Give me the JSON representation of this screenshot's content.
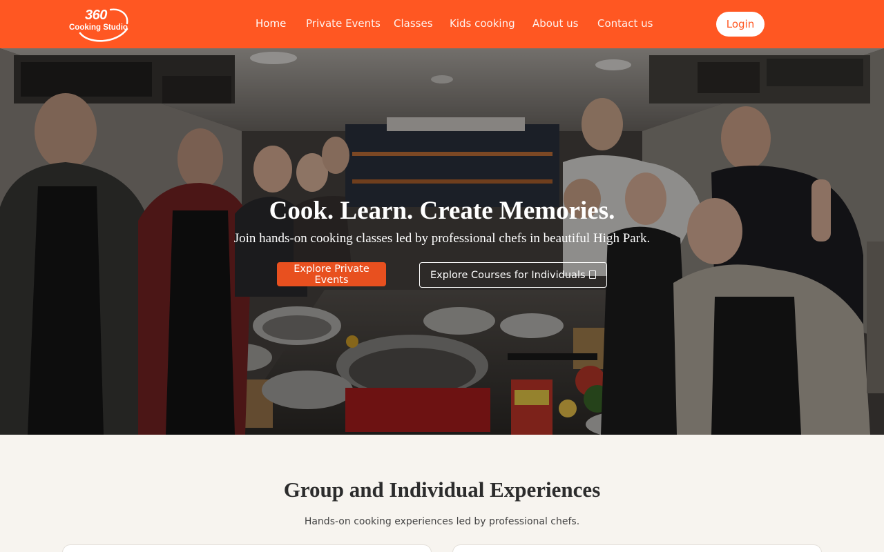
{
  "brand": {
    "logo_number": "360",
    "logo_text": "Cooking Studio"
  },
  "nav": {
    "items": [
      {
        "label": "Home"
      },
      {
        "label": "Private Events"
      },
      {
        "label": "Classes"
      },
      {
        "label": "Kids cooking"
      },
      {
        "label": "About us"
      },
      {
        "label": "Contact us"
      }
    ],
    "active": "Home",
    "login_label": "Login"
  },
  "hero": {
    "title": "Cook. Learn. Create Memories.",
    "subtitle": "Join hands-on cooking classes led by professional chefs in beautiful High Park.",
    "primary_button": "Explore Private Events",
    "secondary_button": "Explore Courses for Individuals",
    "secondary_button_icon": "external-link-icon"
  },
  "section": {
    "title": "Group and Individual Experiences",
    "subtitle": "Hands-on cooking experiences led by professional chefs."
  },
  "colors": {
    "brand_orange": "#ff5722",
    "button_orange": "#e8501f",
    "page_background": "#f7f4ef"
  }
}
